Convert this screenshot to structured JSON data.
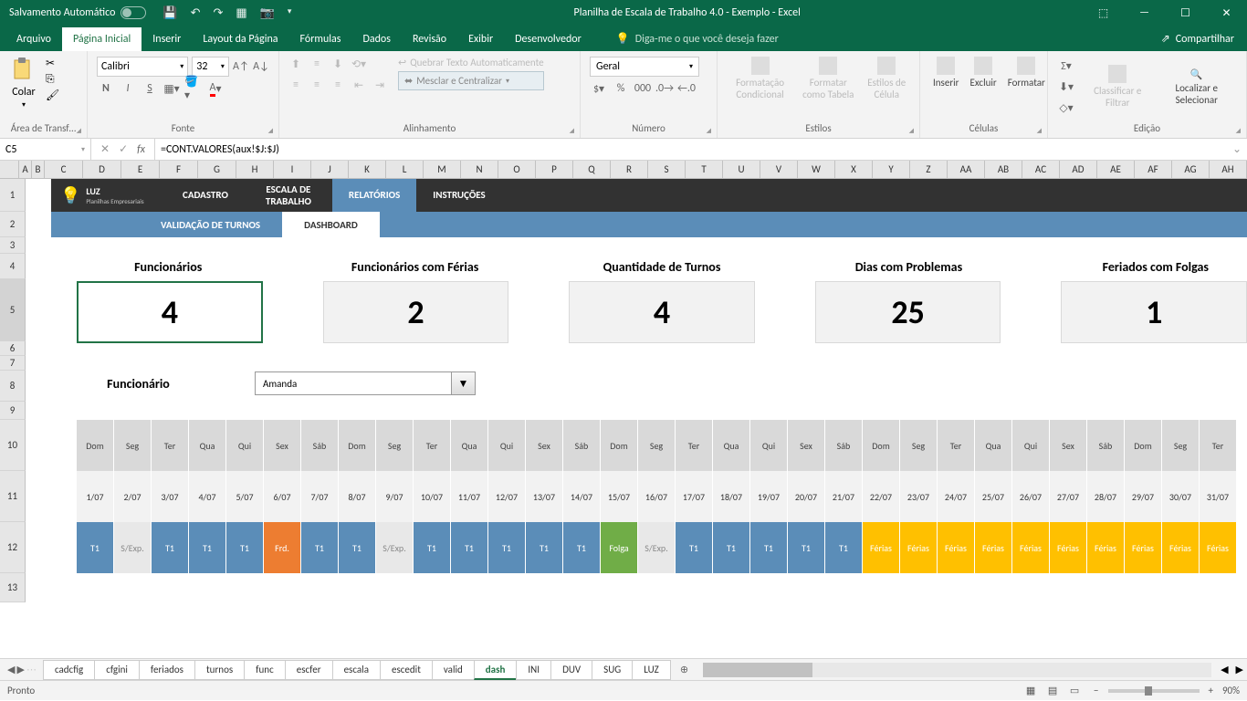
{
  "titlebar": {
    "autosave": "Salvamento Automático",
    "title": "Planilha de Escala de Trabalho 4.0 - Exemplo  -  Excel"
  },
  "tabs": {
    "file": "Arquivo",
    "home": "Página Inicial",
    "insert": "Inserir",
    "layout": "Layout da Página",
    "formulas": "Fórmulas",
    "data": "Dados",
    "review": "Revisão",
    "view": "Exibir",
    "developer": "Desenvolvedor",
    "tellme": "Diga-me o que você deseja fazer",
    "share": "Compartilhar"
  },
  "ribbon": {
    "paste": "Colar",
    "clipboard": "Área de Transf…",
    "font_name": "Calibri",
    "font_size": "32",
    "font": "Fonte",
    "wrap": "Quebrar Texto Automaticamente",
    "merge": "Mesclar e Centralizar",
    "alignment": "Alinhamento",
    "general": "Geral",
    "number": "Número",
    "cond": "Formatação Condicional",
    "table": "Formatar como Tabela",
    "cellstyle": "Estilos de Célula",
    "styles": "Estilos",
    "insert": "Inserir",
    "delete": "Excluir",
    "format": "Formatar",
    "cells": "Células",
    "sort": "Classificar e Filtrar",
    "find": "Localizar e Selecionar",
    "editing": "Edição"
  },
  "namebox": "C5",
  "formula": "=CONT.VALORES(aux!$J:$J)",
  "columns": [
    "A",
    "B",
    "C",
    "D",
    "E",
    "F",
    "G",
    "H",
    "I",
    "J",
    "K",
    "L",
    "M",
    "N",
    "O",
    "P",
    "Q",
    "R",
    "S",
    "T",
    "U",
    "V",
    "W",
    "X",
    "Y",
    "Z",
    "AA",
    "AB",
    "AC",
    "AD",
    "AE",
    "AF",
    "AG",
    "AH"
  ],
  "rows": [
    "1",
    "2",
    "3",
    "4",
    "5",
    "6",
    "7",
    "8",
    "9",
    "10",
    "11",
    "12",
    "13"
  ],
  "nav": {
    "logo_main": "LUZ",
    "logo_sub": "Planilhas Empresariais",
    "cadastro": "CADASTRO",
    "escala": "ESCALA DE TRABALHO",
    "relatorios": "RELATÓRIOS",
    "instrucoes": "INSTRUÇÕES"
  },
  "subnav": {
    "validacao": "VALIDAÇÃO DE TURNOS",
    "dashboard": "DASHBOARD"
  },
  "kpi": {
    "t1": "Funcionários",
    "v1": "4",
    "t2": "Funcionários com Férias",
    "v2": "2",
    "t3": "Quantidade de Turnos",
    "v3": "4",
    "t4": "Dias com Problemas",
    "v4": "25",
    "t5": "Feriados com Folgas",
    "v5": "1"
  },
  "func": {
    "label": "Funcionário",
    "value": "Amanda"
  },
  "calendar": {
    "days": [
      "Dom",
      "Seg",
      "Ter",
      "Qua",
      "Qui",
      "Sex",
      "Sáb",
      "Dom",
      "Seg",
      "Ter",
      "Qua",
      "Qui",
      "Sex",
      "Sáb",
      "Dom",
      "Seg",
      "Ter",
      "Qua",
      "Qui",
      "Sex",
      "Sáb",
      "Dom",
      "Seg",
      "Ter",
      "Qua",
      "Qui",
      "Sex",
      "Sáb",
      "Dom",
      "Seg",
      "Ter"
    ],
    "dates": [
      "1/07",
      "2/07",
      "3/07",
      "4/07",
      "5/07",
      "6/07",
      "7/07",
      "8/07",
      "9/07",
      "10/07",
      "11/07",
      "12/07",
      "13/07",
      "14/07",
      "15/07",
      "16/07",
      "17/07",
      "18/07",
      "19/07",
      "20/07",
      "21/07",
      "22/07",
      "23/07",
      "24/07",
      "25/07",
      "26/07",
      "27/07",
      "28/07",
      "29/07",
      "30/07",
      "31/07"
    ],
    "shifts": [
      "T1",
      "S/Exp.",
      "T1",
      "T1",
      "T1",
      "Frd.",
      "T1",
      "T1",
      "S/Exp.",
      "T1",
      "T1",
      "T1",
      "T1",
      "T1",
      "Folga",
      "S/Exp.",
      "T1",
      "T1",
      "T1",
      "T1",
      "T1",
      "Férias",
      "Férias",
      "Férias",
      "Férias",
      "Férias",
      "Férias",
      "Férias",
      "Férias",
      "Férias",
      "Férias"
    ]
  },
  "sheets": [
    "cadcfig",
    "cfgini",
    "feriados",
    "turnos",
    "func",
    "escfer",
    "escala",
    "escedit",
    "valid",
    "dash",
    "INI",
    "DUV",
    "SUG",
    "LUZ"
  ],
  "active_sheet": "dash",
  "status": {
    "ready": "Pronto",
    "zoom": "90%"
  }
}
